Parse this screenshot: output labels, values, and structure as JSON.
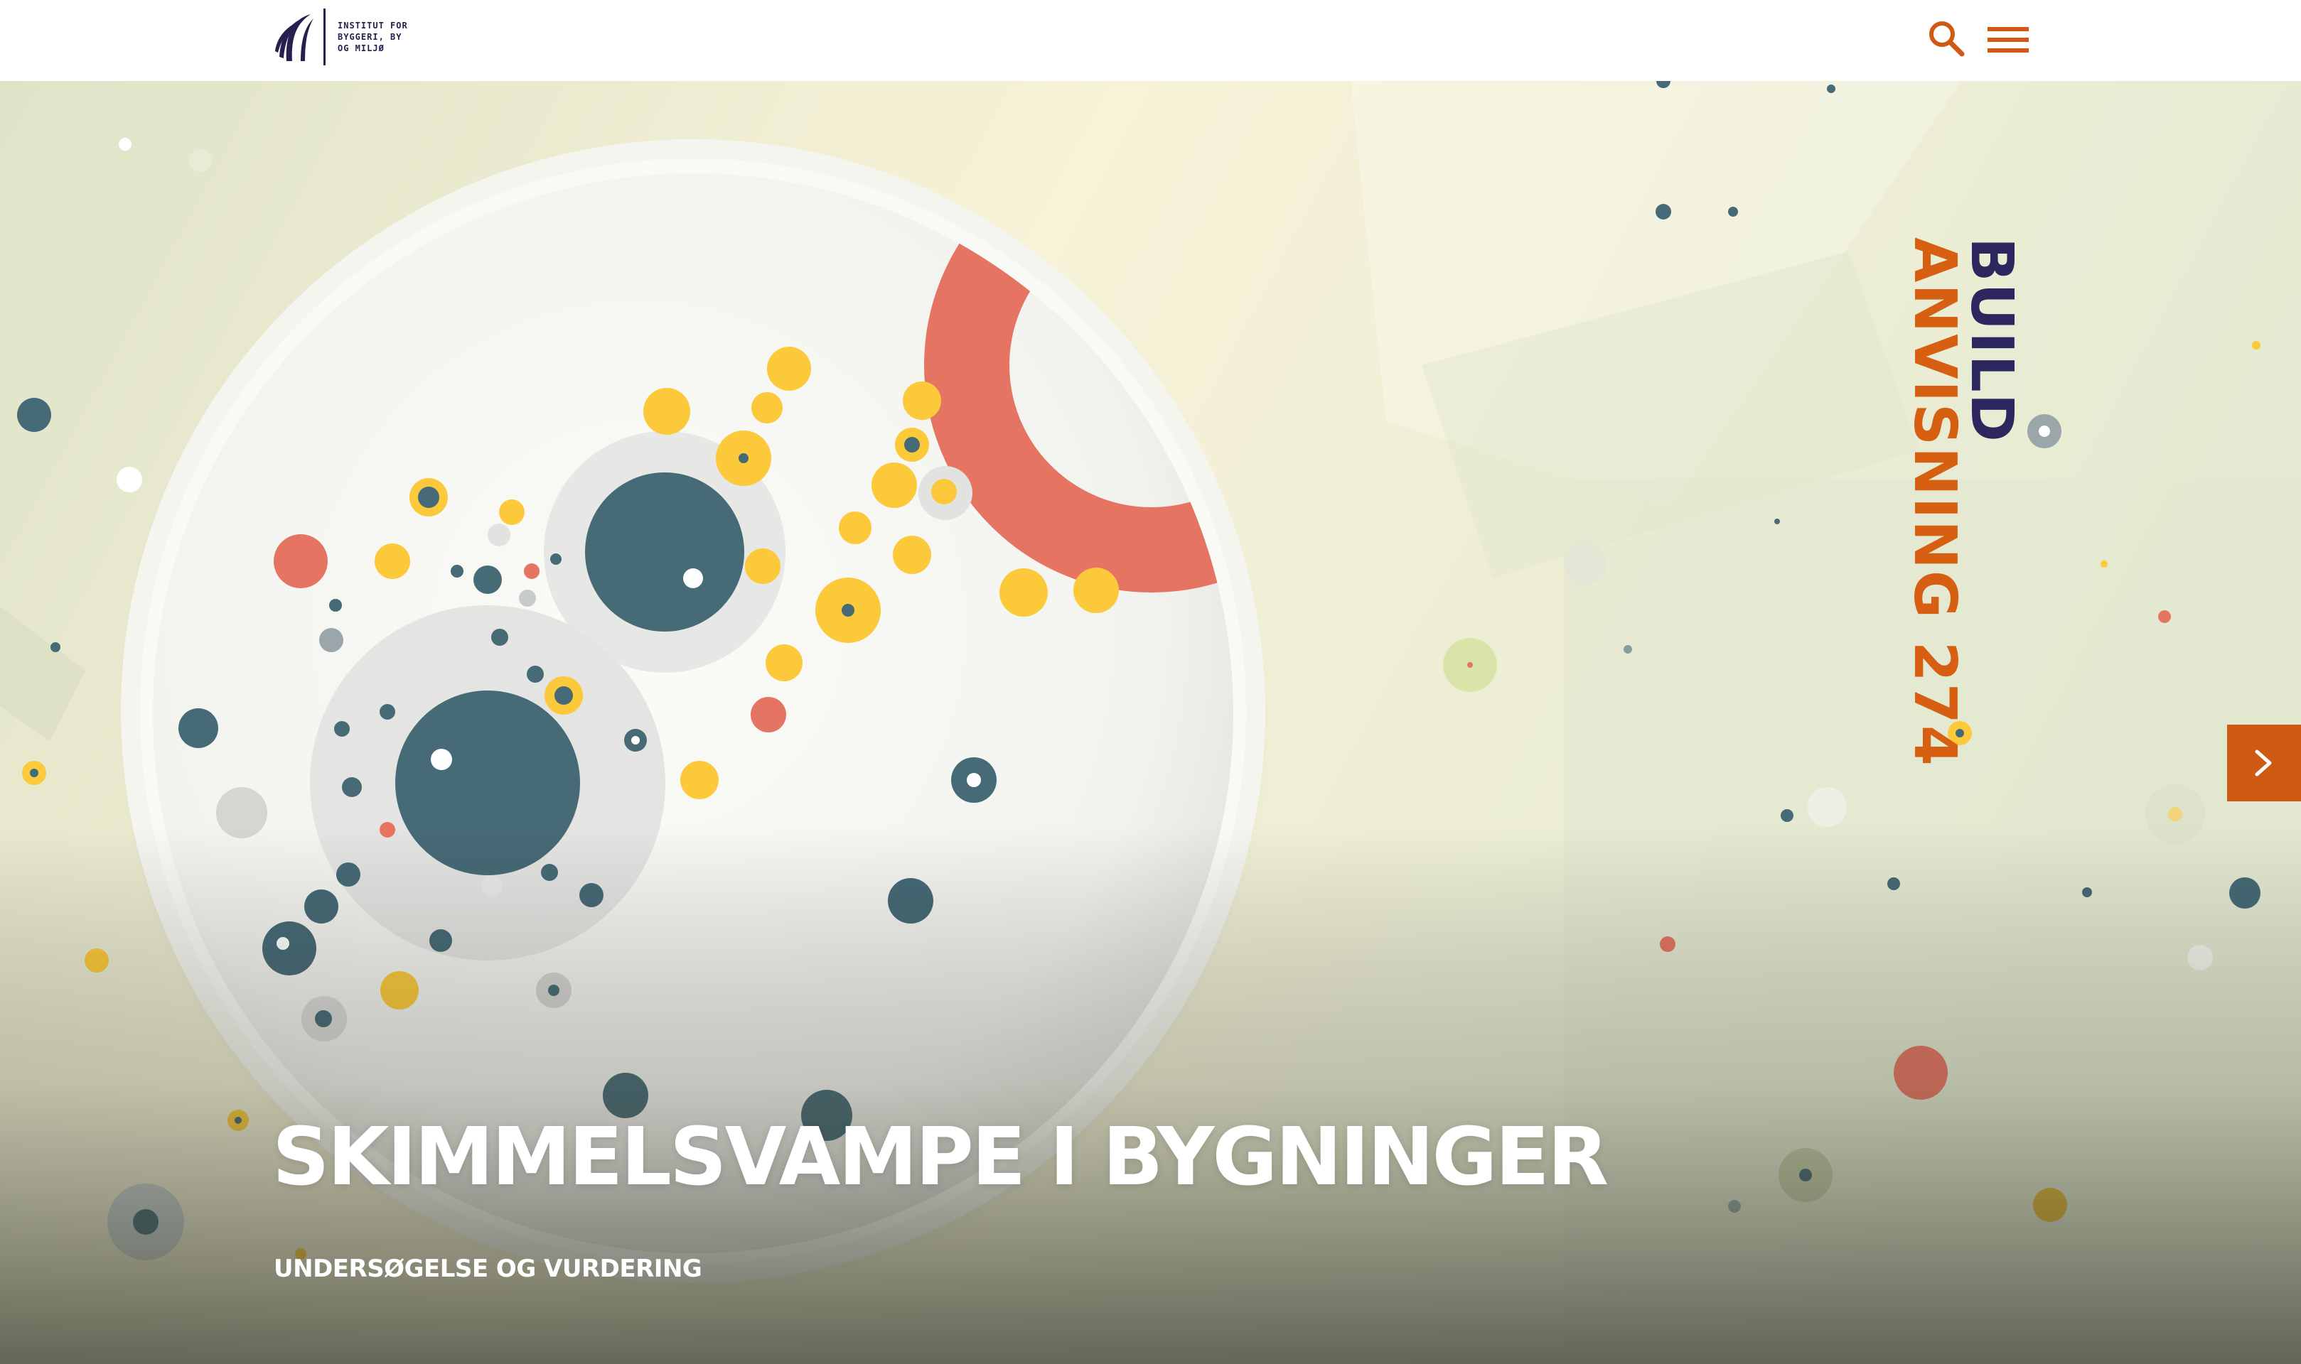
{
  "header": {
    "logo": {
      "lines": [
        "INSTITUT FOR",
        "BYGGERI, BY",
        "OG MILJØ"
      ]
    },
    "search_icon": "search-icon",
    "menu_icon": "hamburger-menu-icon",
    "accent_color": "#cf5a13",
    "brand_color": "#27204f"
  },
  "hero": {
    "vertical_title": {
      "line1": "BUILD",
      "line2": "ANVISNING 274"
    },
    "title": "SKIMMELSVAMPE I BYGNINGER",
    "subtitle": "UNDERSØGELSE OG VURDERING",
    "next_icon": "chevron-right-icon",
    "colors": {
      "dark_teal": "#466a76",
      "yellow": "#fbc93a",
      "coral": "#e67462",
      "dish": "#f4f4ef"
    }
  }
}
